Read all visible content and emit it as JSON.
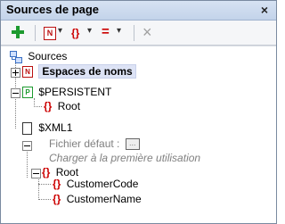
{
  "window": {
    "title": "Sources de page",
    "close_glyph": "×"
  },
  "toolbar": {
    "items": [
      {
        "name": "add-source-button",
        "icon": "plus-icon"
      },
      {
        "name": "add-namespace-button",
        "icon": "namespace-icon"
      },
      {
        "name": "add-element-button",
        "icon": "curly-braces-icon"
      },
      {
        "name": "add-parameter-button",
        "icon": "equals-icon"
      },
      {
        "name": "delete-button",
        "icon": "delete-x-icon"
      }
    ],
    "glyphs": {
      "namespace": "N",
      "element": "{}",
      "parameter": "=",
      "delete": "×",
      "dropdown": "▾"
    }
  },
  "tree": {
    "root_label": "Sources",
    "namespaces_label": "Espaces de noms",
    "persistent_label": "$PERSISTENT",
    "persistent_root_label": "Root",
    "xml_label": "$XML1",
    "default_file_label": "Fichier défaut :",
    "default_file_button": "...",
    "load_hint": "Charger à la première utilisation",
    "xml_root_label": "Root",
    "children": [
      "CustomerCode",
      "CustomerName"
    ],
    "glyphs": {
      "element": "{}",
      "namespace": "N",
      "persistent": "P"
    }
  }
}
